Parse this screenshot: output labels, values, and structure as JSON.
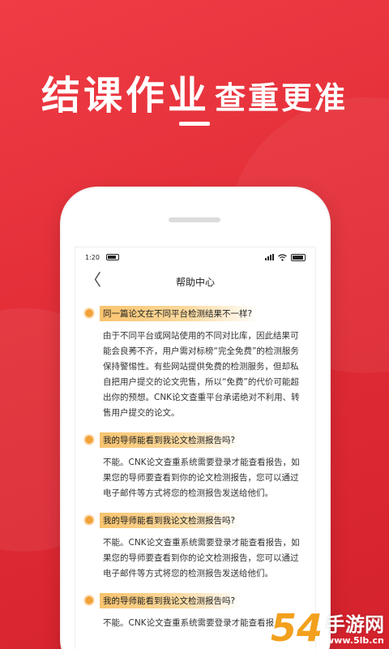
{
  "headline": {
    "big": "结课作业",
    "small": "查重更准"
  },
  "status": {
    "time": "1:20"
  },
  "nav": {
    "back_glyph": "〈",
    "title": "帮助中心"
  },
  "qa": [
    {
      "question": "同一篇论文在不同平台检测结果不一样?",
      "answer": "由于不同平台或网站使用的不同对比库，因此结果可能会良莠不齐，用户需对标榜“完全免费”的检测服务保持警惕性。有些网站提供免费的检测服务，但却私自把用户提交的论文兜售，所以“免费”的代价可能超出你的预想。CNK论文查重平台承诺绝对不利用、转售用户提交的论文。"
    },
    {
      "question": "我的导师能看到我论文检测报告吗?",
      "answer": "不能。CNK论文查重系统需要登录才能查看报告，如果您的导师要查看到你的论文检测报告，您可以通过电子邮件等方式将您的检测报告发送给他们。"
    },
    {
      "question": "我的导师能看到我论文检测报告吗?",
      "answer": "不能。CNK论文查重系统需要登录才能查看报告，如果您的导师要查看到你的论文检测报告，您可以通过电子邮件等方式将您的检测报告发送给他们。"
    },
    {
      "question": "我的导师能看到我论文检测报告吗?",
      "answer": "不能。CNK论文查重系统需要登录才能查看报告，"
    }
  ],
  "watermark": {
    "number": "54",
    "cn": "手游网",
    "url": "www.5lb.cn"
  },
  "colors": {
    "brand_red": "#e5303a",
    "accent_orange": "#f2a23a"
  }
}
